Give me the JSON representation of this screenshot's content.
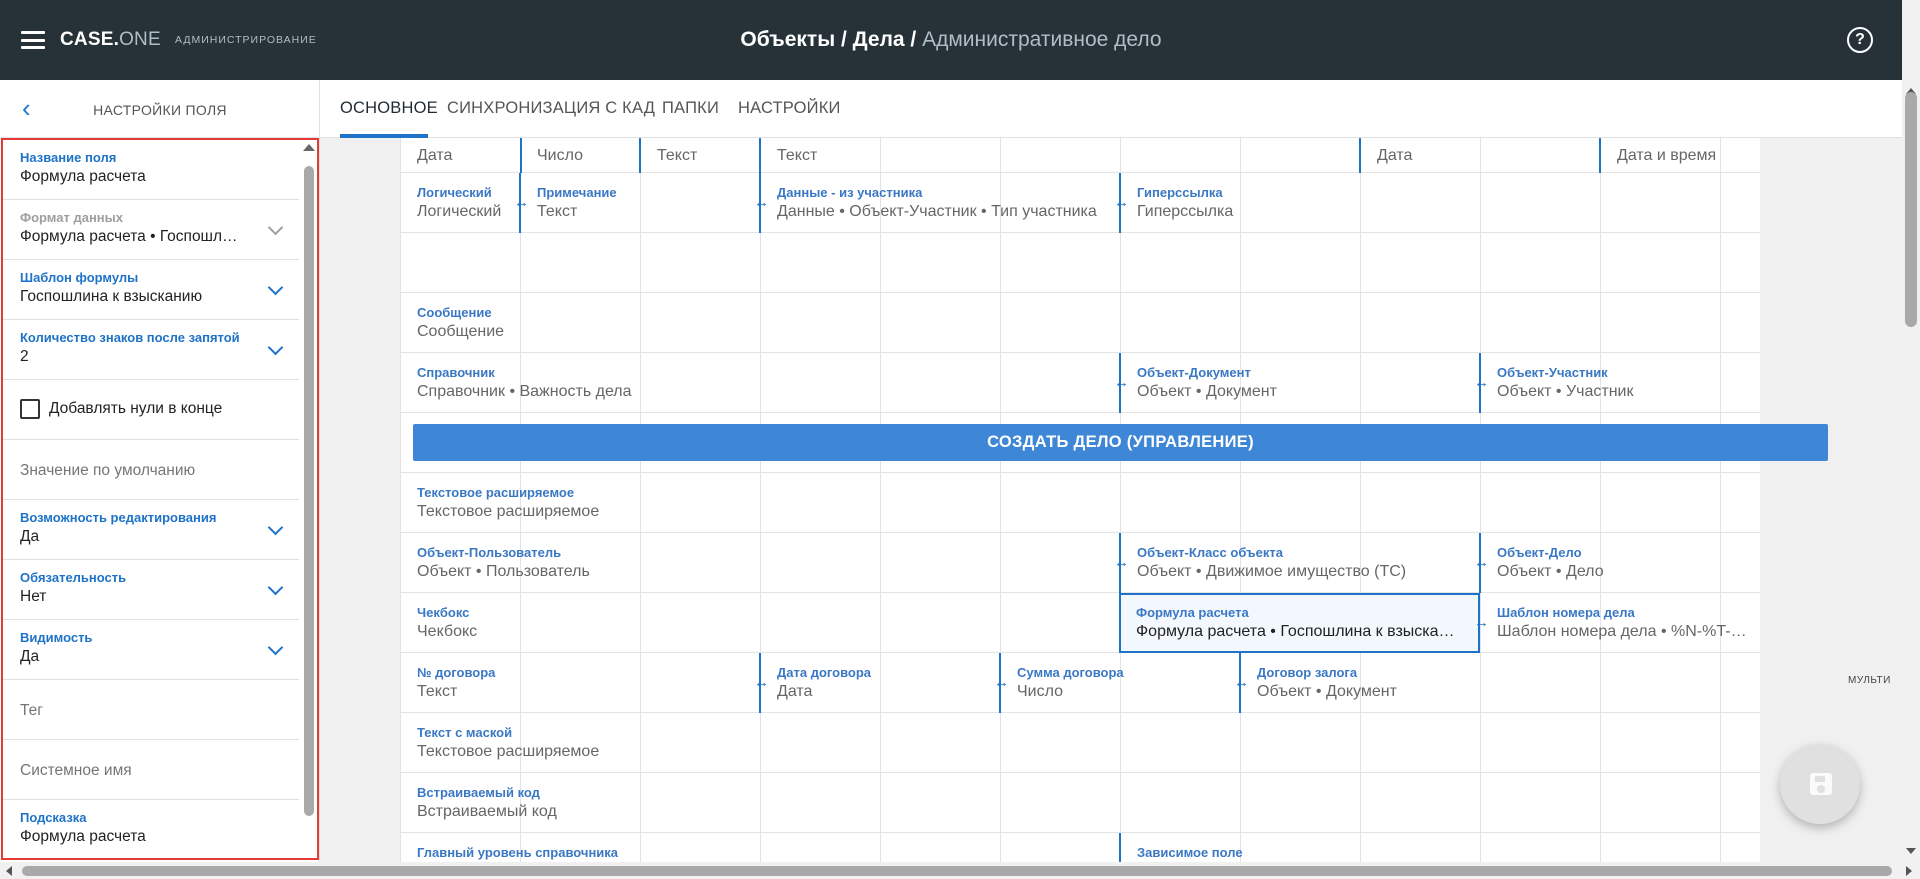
{
  "header": {
    "logo_main": "CASE.",
    "logo_accent": "ONE",
    "logo_sub": "АДМИНИСТРИРОВАНИЕ",
    "crumb_1": "Объекты",
    "crumb_sep": " / ",
    "crumb_2": "Дела",
    "crumb_3": "Административное дело",
    "help": "?"
  },
  "left_panel": {
    "title": "НАСТРОЙКИ ПОЛЯ",
    "back": "‹",
    "fields": {
      "name": {
        "label": "Название поля",
        "value": "Формула расчета"
      },
      "format": {
        "label": "Формат данных",
        "value": "Формула расчета • Госпошлина к взысканию"
      },
      "template": {
        "label": "Шаблон формулы",
        "value": "Госпошлина к взысканию"
      },
      "decimals": {
        "label": "Количество знаков после запятой",
        "value": "2"
      },
      "trailing_zeros": {
        "label": "Добавлять нули в конце",
        "checked": false
      },
      "default": {
        "placeholder": "Значение по умолчанию"
      },
      "editable": {
        "label": "Возможность редактирования",
        "value": "Да"
      },
      "required": {
        "label": "Обязательность",
        "value": "Нет"
      },
      "visible": {
        "label": "Видимость",
        "value": "Да"
      },
      "tag": {
        "placeholder": "Тег"
      },
      "system_name": {
        "placeholder": "Системное имя"
      },
      "hint": {
        "label": "Подсказка",
        "value": "Формула расчета"
      }
    }
  },
  "tabs": [
    "ОСНОВНОЕ",
    "СИНХРОНИЗАЦИЯ С КАД",
    "ПАПКИ",
    "НАСТРОЙКИ"
  ],
  "grid": {
    "row0": [
      "Дата",
      "Число",
      "Текст",
      "Текст",
      "Дата",
      "Дата и время"
    ],
    "row1": [
      {
        "label": "Логический",
        "value": "Логический"
      },
      {
        "label": "Примечание",
        "value": "Текст"
      },
      {
        "label": "Данные - из участника",
        "value": "Данные • Объект-Участник • Тип участника"
      },
      {
        "label": "Гиперссылка",
        "value": "Гиперссылка"
      }
    ],
    "row3": [
      {
        "label": "Сообщение",
        "value": "Сообщение"
      }
    ],
    "row4": [
      {
        "label": "Справочник",
        "value": "Справочник • Важность дела"
      },
      {
        "label": "Объект-Документ",
        "value": "Объект • Документ"
      },
      {
        "label": "Объект-Участник",
        "value": "Объект • Участник"
      }
    ],
    "create_button": "СОЗДАТЬ ДЕЛО (УПРАВЛЕНИЕ)",
    "row6": [
      {
        "label": "Текстовое расширяемое",
        "value": "Текстовое расширяемое"
      }
    ],
    "row7": [
      {
        "label": "Объект-Пользователь",
        "value": "Объект • Пользователь"
      },
      {
        "label": "Объект-Класс объекта",
        "value": "Объект • Движимое имущество (ТС)"
      },
      {
        "label": "Объект-Дело",
        "value": "Объект • Дело"
      }
    ],
    "row8": [
      {
        "label": "Чекбокс",
        "value": "Чекбокс"
      },
      {
        "label": "Формула расчета",
        "value": "Формула расчета • Госпошлина к взысканию"
      },
      {
        "label": "Шаблон номера дела",
        "value": "Шаблон номера дела • %N-%T-%D-%M-%Y"
      }
    ],
    "row9": [
      {
        "label": "№ договора",
        "value": "Текст"
      },
      {
        "label": "Дата договора",
        "value": "Дата"
      },
      {
        "label": "Сумма договора",
        "value": "Число"
      },
      {
        "label": "Договор залога",
        "value": "Объект • Документ"
      }
    ],
    "row10": [
      {
        "label": "Текст с маской",
        "value": "Текстовое расширяемое"
      }
    ],
    "row11": [
      {
        "label": "Встраиваемый код",
        "value": "Встраиваемый код"
      }
    ],
    "row12": [
      {
        "label": "Главный уровень справочника",
        "value": ""
      },
      {
        "label": "Зависимое поле",
        "value": ""
      }
    ],
    "multi_label": "МУЛЬТИ"
  },
  "colors": {
    "accent": "#1e73c8",
    "topbar": "#263238",
    "button": "#3e86d6",
    "highlight": "#e53935"
  }
}
